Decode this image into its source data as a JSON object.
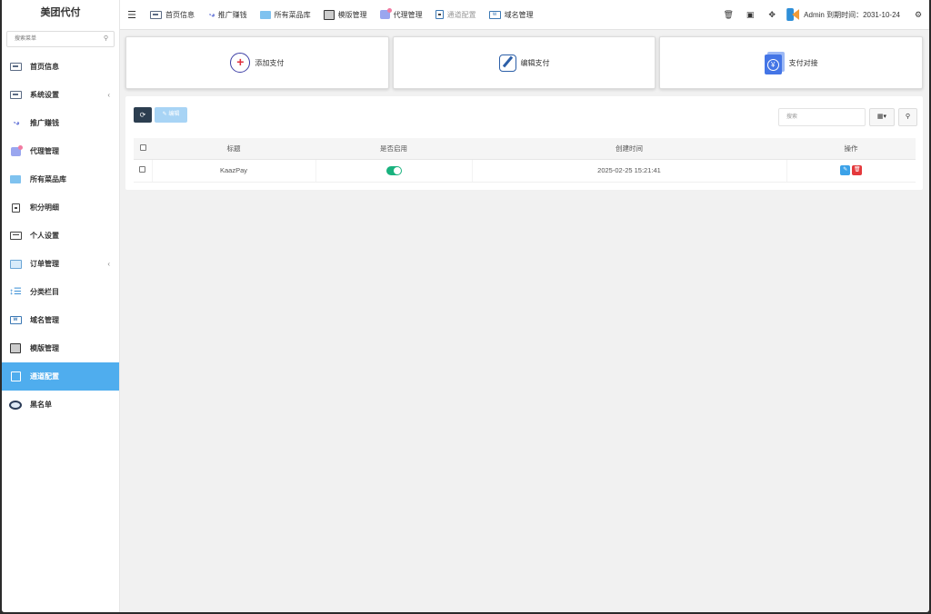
{
  "app": {
    "title": "美团代付"
  },
  "sidebar": {
    "search_placeholder": "搜索菜单",
    "items": [
      {
        "label": "首页信息",
        "icon": "card-icon"
      },
      {
        "label": "系统设置",
        "icon": "card-icon",
        "caret": "‹"
      },
      {
        "label": "推广赚钱",
        "icon": "glasses-icon"
      },
      {
        "label": "代理管理",
        "icon": "bag-icon"
      },
      {
        "label": "所有菜品库",
        "icon": "grid-icon"
      },
      {
        "label": "积分明细",
        "icon": "doc-icon"
      },
      {
        "label": "个人设置",
        "icon": "id-card-icon"
      },
      {
        "label": "订单管理",
        "icon": "order-icon",
        "caret": "‹"
      },
      {
        "label": "分类栏目",
        "icon": "sort-icon"
      },
      {
        "label": "域名管理",
        "icon": "domain-icon"
      },
      {
        "label": "模版管理",
        "icon": "template-icon"
      },
      {
        "label": "通道配置",
        "icon": "channel-icon",
        "active": true
      },
      {
        "label": "黑名单",
        "icon": "blacklist-icon"
      }
    ]
  },
  "topbar": {
    "tabs": [
      {
        "label": "首页信息"
      },
      {
        "label": "推广赚钱"
      },
      {
        "label": "所有菜品库"
      },
      {
        "label": "模版管理"
      },
      {
        "label": "代理管理"
      },
      {
        "label": "通道配置"
      },
      {
        "label": "域名管理"
      }
    ],
    "user_label": "Admin 到期时间：2031-10-24"
  },
  "cards": {
    "add_label": "添加支付",
    "edit_label": "编辑支付",
    "connect_label": "支付对接"
  },
  "toolbar": {
    "edit_label": "✎ 编辑",
    "search_placeholder": "搜索"
  },
  "table": {
    "headers": {
      "title": "标题",
      "enabled": "是否启用",
      "created": "创建时间",
      "action": "操作"
    },
    "rows": [
      {
        "title": "KaazPay",
        "enabled": true,
        "created": "2025-02-25 15:21:41"
      }
    ]
  },
  "colors": {
    "accent": "#4fadee",
    "switch_on": "#19b27e",
    "danger": "#e4393c",
    "primary": "#3ca2e8"
  }
}
